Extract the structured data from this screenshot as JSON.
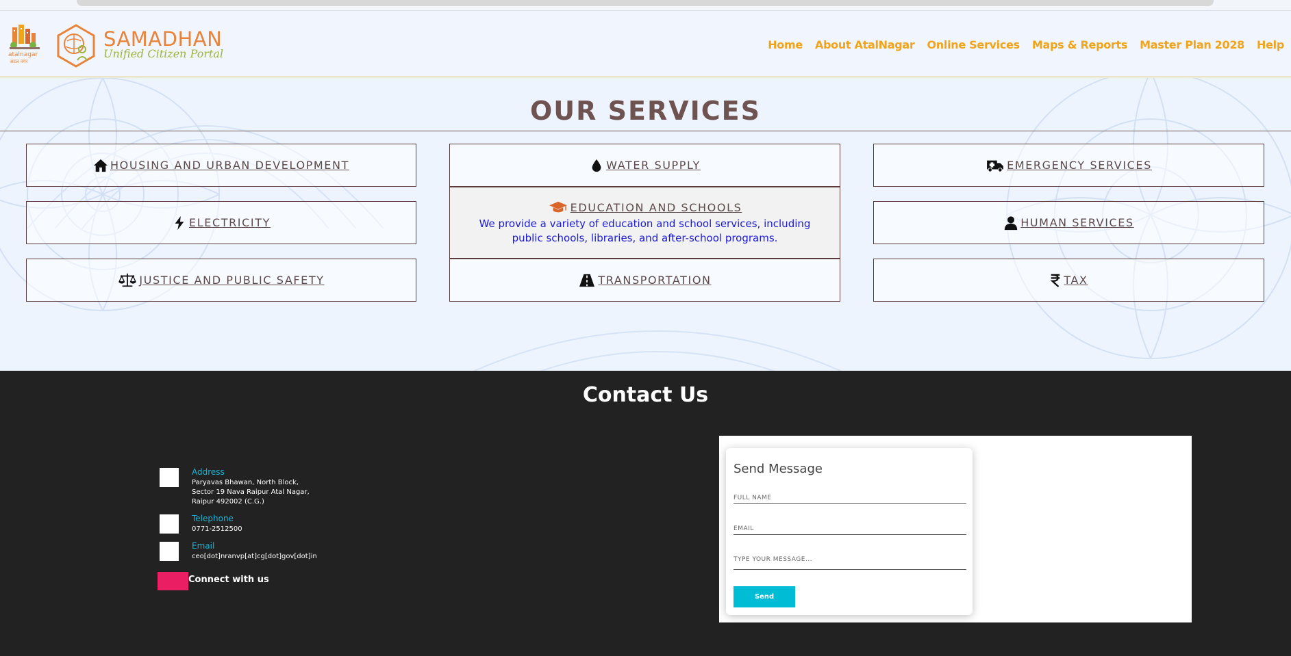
{
  "header": {
    "atal_logo_text": "atalnagar",
    "atal_logo_hindi": "अटल नगर",
    "brand_title": "SAMADHAN",
    "brand_subtitle": "Unified Citizen Portal",
    "nav": [
      "Home",
      "About AtalNagar",
      "Online Services",
      "Maps & Reports",
      "Master Plan 2028",
      "Help"
    ]
  },
  "services": {
    "heading": "OUR SERVICES",
    "cards": [
      {
        "label": "HOUSING AND URBAN DEVELOPMENT",
        "icon": "home-icon"
      },
      {
        "label": "WATER SUPPLY",
        "icon": "droplet-icon"
      },
      {
        "label": "EMERGENCY SERVICES",
        "icon": "ambulance-icon"
      },
      {
        "label": "ELECTRICITY",
        "icon": "bolt-icon"
      },
      {
        "label": "EDUCATION AND SCHOOLS",
        "icon": "graduation-cap-icon",
        "description": "We provide a variety of education and school services, including public schools, libraries, and after-school programs."
      },
      {
        "label": "HUMAN SERVICES",
        "icon": "user-icon"
      },
      {
        "label": "JUSTICE AND PUBLIC SAFETY",
        "icon": "scales-icon"
      },
      {
        "label": "TRANSPORTATION",
        "icon": "road-icon"
      },
      {
        "label": "TAX",
        "icon": "rupee-icon"
      }
    ]
  },
  "contact": {
    "heading": "Contact Us",
    "address_title": "Address",
    "address_lines": [
      "Paryavas Bhawan, North Block,",
      "Sector 19 Nava Raipur Atal Nagar,",
      "Raipur 492002 (C.G.)"
    ],
    "telephone_title": "Telephone",
    "telephone": "0771-2512500",
    "email_title": "Email",
    "email": "ceo[dot]nranvp[at]cg[dot]gov[dot]in",
    "connect": "Connect with us",
    "form": {
      "title": "Send Message",
      "full_name": "FULL NAME",
      "email": "EMAIL",
      "message": "TYPE YOUR MESSAGE...",
      "send": "Send"
    }
  },
  "colors": {
    "nav": "#f0a41c",
    "brand": "#e8833a",
    "heading": "#6f5351",
    "accent": "#18b6d6",
    "send_button": "#00bcd4",
    "footer": "#222222"
  }
}
